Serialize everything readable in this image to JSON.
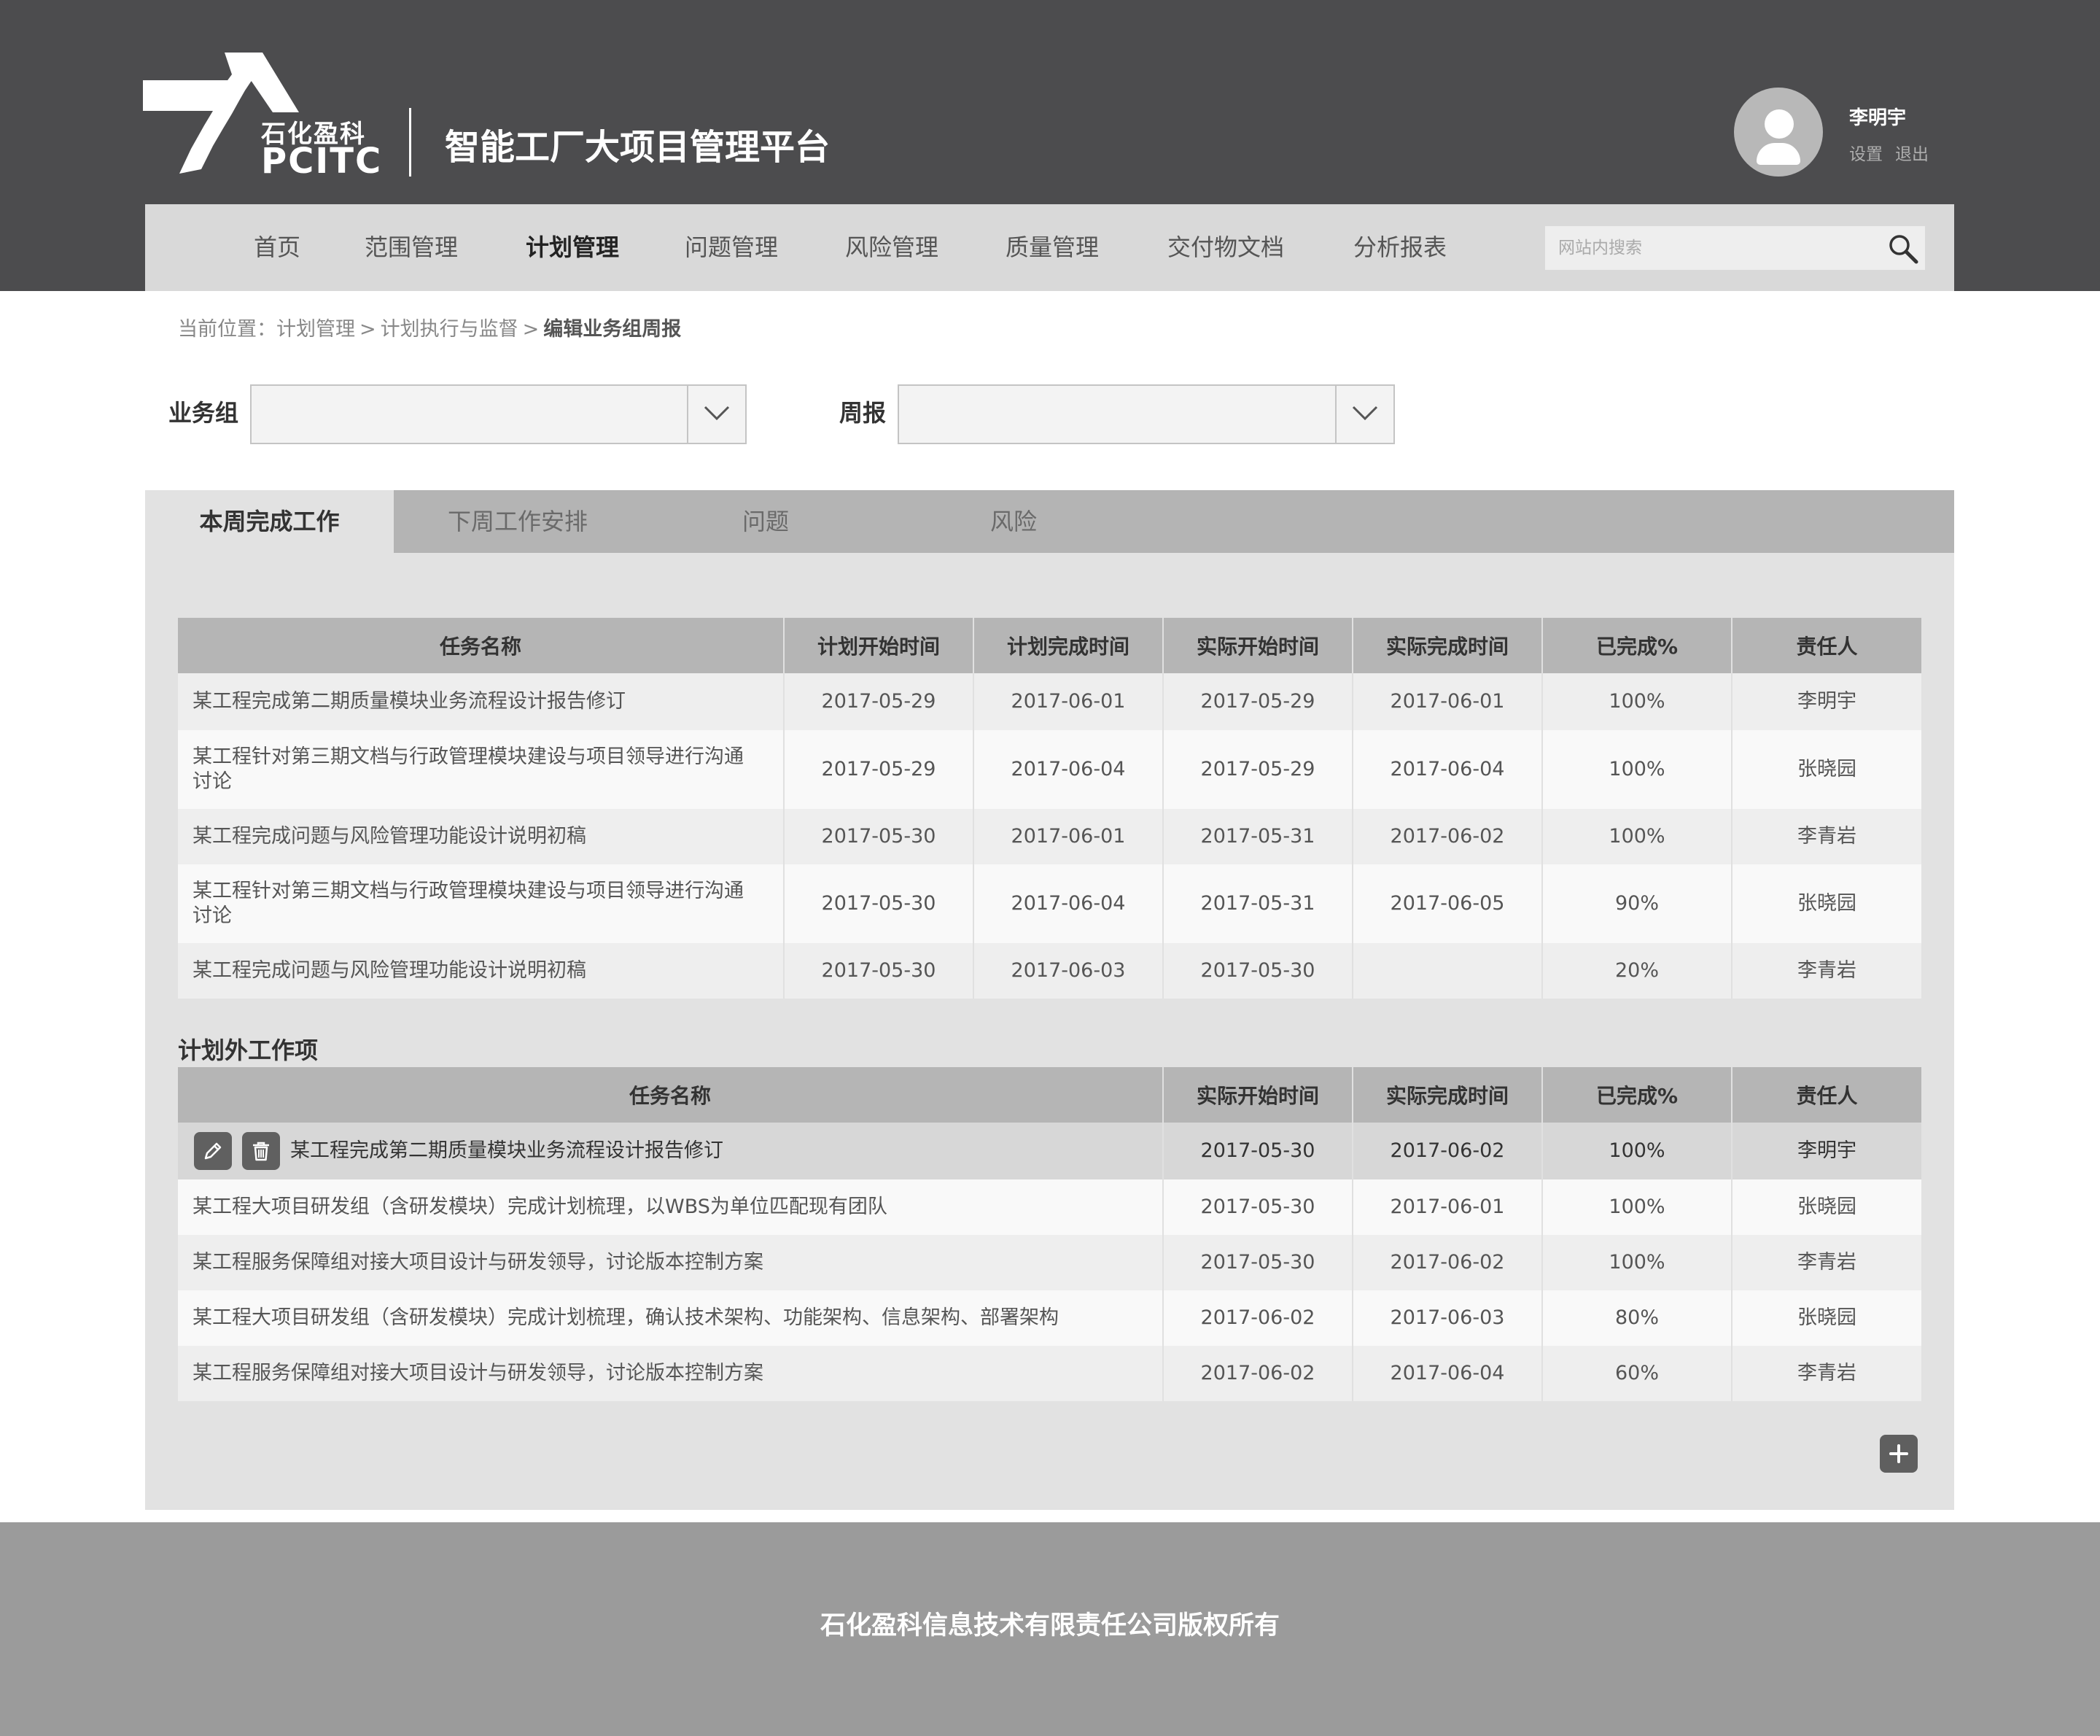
{
  "header": {
    "logo_cn": "石化盈科",
    "logo_en": "PCITC",
    "app_title": "智能工厂大项目管理平台",
    "user": {
      "name": "李明宇",
      "settings_label": "设置",
      "logout_label": "退出"
    }
  },
  "nav": {
    "items": [
      {
        "label": "首页",
        "active": false
      },
      {
        "label": "范围管理",
        "active": false
      },
      {
        "label": "计划管理",
        "active": true
      },
      {
        "label": "问题管理",
        "active": false
      },
      {
        "label": "风险管理",
        "active": false
      },
      {
        "label": "质量管理",
        "active": false
      },
      {
        "label": "交付物文档",
        "active": false
      },
      {
        "label": "分析报表",
        "active": false
      }
    ],
    "search": {
      "placeholder": "网站内搜索",
      "value": ""
    }
  },
  "breadcrumb": {
    "prefix": "当前位置：",
    "items": [
      "计划管理",
      "计划执行与监督"
    ],
    "separator": ">",
    "current": "编辑业务组周报"
  },
  "filters": {
    "group": {
      "label": "业务组",
      "value": ""
    },
    "weekly": {
      "label": "周报",
      "value": ""
    }
  },
  "tabs": [
    {
      "label": "本周完成工作",
      "active": true
    },
    {
      "label": "下周工作安排",
      "active": false
    },
    {
      "label": "问题",
      "active": false
    },
    {
      "label": "风险",
      "active": false
    }
  ],
  "planned_table": {
    "columns": [
      "任务名称",
      "计划开始时间",
      "计划完成时间",
      "实际开始时间",
      "实际完成时间",
      "已完成%",
      "责任人"
    ],
    "rows": [
      [
        "某工程完成第二期质量模块业务流程设计报告修订",
        "2017-05-29",
        "2017-06-01",
        "2017-05-29",
        "2017-06-01",
        "100%",
        "李明宇"
      ],
      [
        "某工程针对第三期文档与行政管理模块建设与项目领导进行沟通讨论",
        "2017-05-29",
        "2017-06-04",
        "2017-05-29",
        "2017-06-04",
        "100%",
        "张晓园"
      ],
      [
        "某工程完成问题与风险管理功能设计说明初稿",
        "2017-05-30",
        "2017-06-01",
        "2017-05-31",
        "2017-06-02",
        "100%",
        "李青岩"
      ],
      [
        "某工程针对第三期文档与行政管理模块建设与项目领导进行沟通讨论",
        "2017-05-30",
        "2017-06-04",
        "2017-05-31",
        "2017-06-05",
        "90%",
        "张晓园"
      ],
      [
        "某工程完成问题与风险管理功能设计说明初稿",
        "2017-05-30",
        "2017-06-03",
        "2017-05-30",
        "",
        "20%",
        "李青岩"
      ]
    ]
  },
  "unplanned_section": {
    "title": "计划外工作项",
    "columns": [
      "任务名称",
      "实际开始时间",
      "实际完成时间",
      "已完成%",
      "责任人"
    ],
    "rows": [
      [
        "某工程完成第二期质量模块业务流程设计报告修订",
        "2017-05-30",
        "2017-06-02",
        "100%",
        "李明宇"
      ],
      [
        "某工程大项目研发组（含研发模块）完成计划梳理，以WBS为单位匹配现有团队",
        "2017-05-30",
        "2017-06-01",
        "100%",
        "张晓园"
      ],
      [
        "某工程服务保障组对接大项目设计与研发领导，讨论版本控制方案",
        "2017-05-30",
        "2017-06-02",
        "100%",
        "李青岩"
      ],
      [
        "某工程大项目研发组（含研发模块）完成计划梳理，确认技术架构、功能架构、信息架构、部署架构",
        "2017-06-02",
        "2017-06-03",
        "80%",
        "张晓园"
      ],
      [
        "某工程服务保障组对接大项目设计与研发领导，讨论版本控制方案",
        "2017-06-02",
        "2017-06-04",
        "60%",
        "李青岩"
      ]
    ],
    "selected_row": 0
  },
  "icons": {
    "search": "search-icon",
    "dropdown": "chevron-down-icon",
    "edit": "pencil-icon",
    "delete": "trash-icon",
    "add": "plus-icon",
    "avatar": "user-icon"
  },
  "footer": {
    "copyright": "石化盈科信息技术有限责任公司版权所有"
  },
  "colors": {
    "header_bg": "#4c4c4e",
    "nav_bg": "#d9d9d9",
    "panel_bg": "#e2e2e2",
    "tabbar_bg": "#b4b4b4",
    "table_header_bg": "#b5b5b5",
    "footer_bg": "#9b9b9b"
  }
}
